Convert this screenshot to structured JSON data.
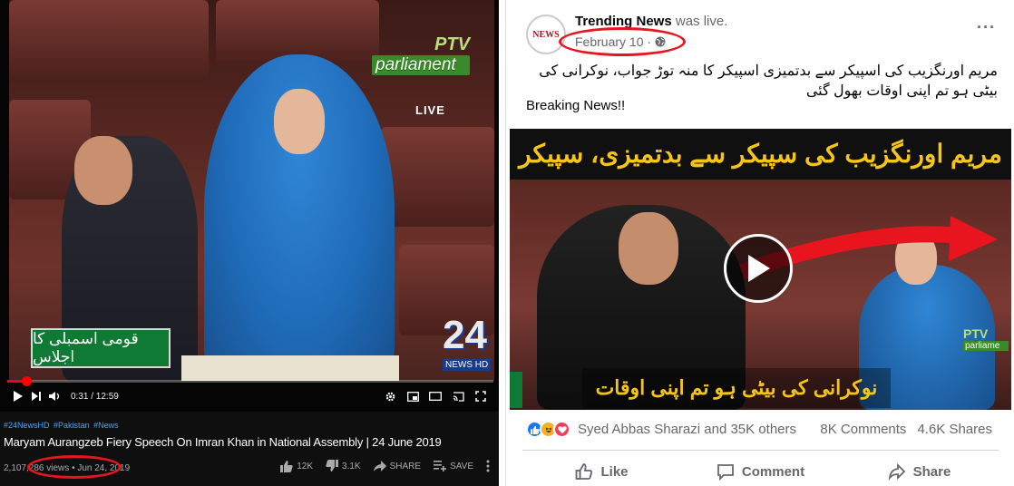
{
  "youtube": {
    "tags": [
      "#24NewsHD",
      "#Pakistan",
      "#News"
    ],
    "title": "Maryam Aurangzeb Fiery Speech On Imran Khan in National Assembly | 24 June 2019",
    "views": "2,107,286 views",
    "date": "Jun 24, 2019",
    "time_display": "0:31 / 12:59",
    "progress_percent": 4,
    "likes": "12K",
    "dislikes": "3.1K",
    "share_label": "SHARE",
    "save_label": "SAVE",
    "video": {
      "ptv_top": "PTV",
      "ptv_bottom": "parliament",
      "live": "LIVE",
      "urdu_caption": "قومی اسمبلی کا اجلاس",
      "channel_num": "24",
      "channel_brand": "NEWS HD"
    }
  },
  "facebook": {
    "avatar_text": "NEWS",
    "page_name": "Trending News",
    "status": "was live.",
    "date": "February 10",
    "text_urdu": "مریم اورنگزیب کی اسپیکر سے بدتمیزی اسپیکر کا منہ توڑ جواب، نوکرانی کی بیٹی ہو تم اپنی اوقات بھول گئی",
    "text_en": "Breaking News!!",
    "video_headline": "مریم اورنگزیب کی سپیکر سے بدتمیزی، سپیکر کا منہ توڑ جواب",
    "video_bottom": "نوکرانی کی بیٹی ہو تم اپنی اوقات بھول گئی",
    "video_ptv_top": "PTV",
    "video_ptv_bottom": "parliame",
    "reactions_text": "Syed Abbas Sharazi and 35K others",
    "comments": "8K Comments",
    "shares": "4.6K Shares",
    "like_label": "Like",
    "comment_label": "Comment",
    "share_label": "Share",
    "colors": {
      "accent": "#1877f2",
      "highlight": "#e8141e"
    }
  }
}
